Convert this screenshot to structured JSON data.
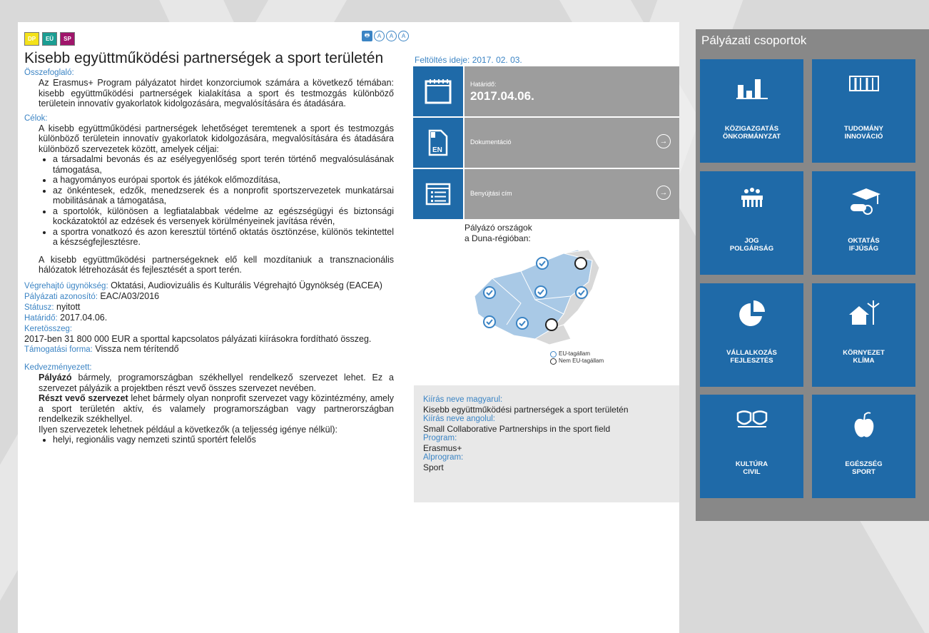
{
  "badges": [
    {
      "label": "DP",
      "color": "#f4e21a"
    },
    {
      "label": "EÜ",
      "color": "#1b9e93"
    },
    {
      "label": "SP",
      "color": "#a0156b"
    }
  ],
  "title": "Kisebb együttműködési partnerségek a sport területén",
  "summary_label": "Összefoglaló:",
  "summary_text": "Az Erasmus+ Program pályázatot hirdet konzorciumok számára a következő témában: kisebb együttműködési partnerségek kialakítása a sport és testmozgás különböző területein innovatív gyakorlatok kidolgozására, megvalósítására és átadására.",
  "goals_label": "Célok:",
  "goals_text": "A kisebb együttműködési partnerségek lehetőséget teremtenek a sport és testmozgás különböző területein innovatív gyakorlatok kidolgozására, megvalósítására és átadására különböző szervezetek között, amelyek céljai:",
  "goals_list": [
    "a társadalmi bevonás és az esélyegyenlőség sport terén történő megvalósulásának támogatása,",
    "a hagyományos európai sportok és játékok előmozdítása,",
    "az önkéntesek, edzők, menedzserek és a nonprofit sportszervezetek munkatársai mobilitásának a támogatása,",
    "a sportolók, különösen a legfiatalabbak védelme az egészségügyi és biztonsági kockázatoktól az edzések és versenyek körülményeinek javítása révén,",
    "a sportra vonatkozó és azon keresztül történő oktatás ösztönzése, különös tekintettel a készségfejlesztésre."
  ],
  "goals_outro": "A kisebb együttműködési partnerségeknek elő kell mozdítaniuk a transznacionális hálózatok létrehozását és fejlesztését a sport terén.",
  "meta": {
    "agency_label": "Végrehajtó ügynökség:",
    "agency": "Oktatási, Audiovizuális és Kulturális Végrehajtó Ügynökség (EACEA)",
    "id_label": "Pályázati azonosító:",
    "id": "EAC/A03/2016",
    "status_label": "Státusz:",
    "status": "nyitott",
    "deadline_label": "Határidő:",
    "deadline": "2017.04.06.",
    "budget_label": "Keretösszeg:",
    "budget": "2017-ben 31 800 000 EUR a sporttal kapcsolatos pályázati kiírásokra fordítható összeg.",
    "support_label": "Támogatási forma:",
    "support": "Vissza nem térítendő"
  },
  "beneficiary_label": "Kedvezményezett:",
  "beneficiary": {
    "p1_bold": "Pályázó",
    "p1": " bármely, programországban székhellyel rendelkező szervezet lehet. Ez a szervezet pályázik a projektben részt vevő összes szervezet nevében.",
    "p2_bold": "Részt vevő szervezet",
    "p2": " lehet bármely olyan nonprofit szervezet vagy közintézmény, amely a sport területén aktív, és valamely programországban vagy partnerországban rendelkezik székhellyel.",
    "p3": "Ilyen szervezetek lehetnek például a következők (a teljesség igénye nélkül):",
    "cut": "helyi, regionális vagy nemzeti szintű sportért felelős"
  },
  "tools": {
    "print": "🖶",
    "a1": "A",
    "a2": "A",
    "a3": "A"
  },
  "upload": "Feltöltés ideje: 2017. 02. 03.",
  "deadline_box": {
    "small": "Határidő:",
    "value": "2017.04.06."
  },
  "doc_box": {
    "label": "Dokumentáció",
    "lang": "EN"
  },
  "submit_box": {
    "label": "Benyújtási cím"
  },
  "map_label": "Pályázó országok\na Duna-régióban:",
  "legend": {
    "eu": "EU-tagállam",
    "noneu": "Nem EU-tagállam"
  },
  "info": {
    "hu_label": "Kiírás neve magyarul:",
    "hu": "Kisebb együttműködési partnerségek a sport területén",
    "en_label": "Kiírás neve angolul:",
    "en": "Small Collaborative Partnerships in the sport field",
    "program_label": "Program:",
    "program": "Erasmus+",
    "sub_label": "Alprogram:",
    "sub": "Sport"
  },
  "sidebar": {
    "title": "Pályázati csoportok",
    "tiles": [
      {
        "l1": "KÖZIGAZGATÁS",
        "l2": "ÖNKORMÁNYZAT",
        "icon": "bar-chart-icon"
      },
      {
        "l1": "TUDOMÁNY",
        "l2": "INNOVÁCIÓ",
        "icon": "books-icon"
      },
      {
        "l1": "JOG",
        "l2": "POLGÁRSÁG",
        "icon": "people-icon"
      },
      {
        "l1": "OKTATÁS",
        "l2": "IFJÚSÁG",
        "icon": "graduation-icon"
      },
      {
        "l1": "VÁLLALKOZÁS",
        "l2": "FEJLESZTÉS",
        "icon": "pie-chart-icon"
      },
      {
        "l1": "KÖRNYEZET",
        "l2": "KLÍMA",
        "icon": "house-wind-icon"
      },
      {
        "l1": "KULTÚRA",
        "l2": "CIVIL",
        "icon": "masks-icon"
      },
      {
        "l1": "EGÉSZSÉG",
        "l2": "SPORT",
        "icon": "apple-icon"
      }
    ]
  }
}
